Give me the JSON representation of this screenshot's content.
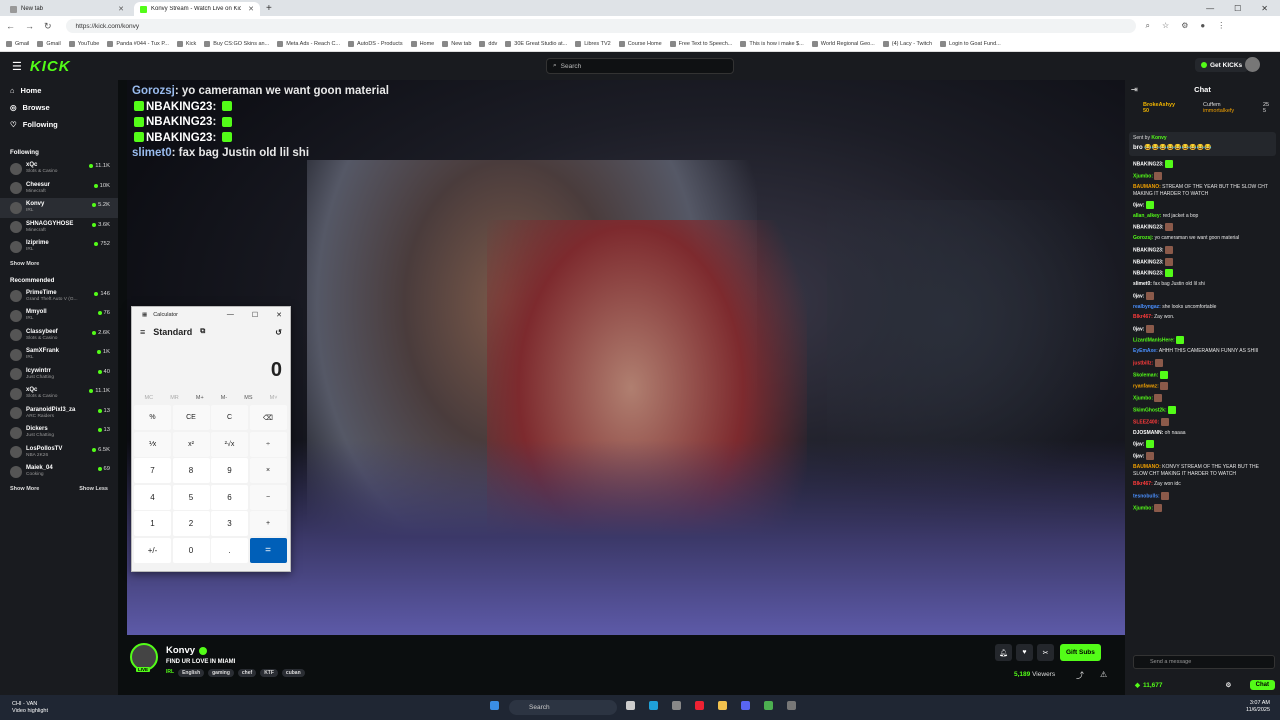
{
  "browser": {
    "tabs": [
      {
        "label": "New tab"
      },
      {
        "label": "Konvy Stream - Watch Live on Kick"
      }
    ],
    "url": "https://kick.com/konvy",
    "bookmarks": [
      "Gmail",
      "Gmail",
      "YouTube",
      "Panda #044 - Tux P...",
      "Kick",
      "Buy CS:GO Skins an...",
      "Meta Ads - Reach C...",
      "AutoDS - Products",
      "Home",
      "New tab",
      "ddv",
      "30E Great Studio at...",
      "Libres TV2",
      "Course Home",
      "Free Text to Speech...",
      "This is how i make $...",
      "World Regional Geo...",
      "(4) Lacy - Twitch",
      "Login to Goat Fund..."
    ]
  },
  "kick": {
    "logo": "KICK",
    "search_placeholder": "Search",
    "get_kicks": "Get KICKs",
    "nav": {
      "home": "Home",
      "browse": "Browse",
      "following": "Following"
    },
    "following_title": "Following",
    "following": [
      {
        "name": "xQc",
        "category": "Slots & Casino",
        "viewers": "11.1K"
      },
      {
        "name": "Cheesur",
        "category": "Minecraft",
        "viewers": "10K"
      },
      {
        "name": "Konvy",
        "category": "IRL",
        "viewers": "5.2K"
      },
      {
        "name": "SHNAGGYHOSE",
        "category": "Minecraft",
        "viewers": "3.6K"
      },
      {
        "name": "Iziprime",
        "category": "IRL",
        "viewers": "752"
      }
    ],
    "show_more": "Show More",
    "recommended_title": "Recommended",
    "recommended": [
      {
        "name": "PrimeTime",
        "category": "Grand Theft Auto V (G...",
        "viewers": "146"
      },
      {
        "name": "Mmyoll",
        "category": "IRL",
        "viewers": "76"
      },
      {
        "name": "Classybeef",
        "category": "Slots & Casino",
        "viewers": "2.6K"
      },
      {
        "name": "SamXFrank",
        "category": "IRL",
        "viewers": "1K"
      },
      {
        "name": "Icywintrr",
        "category": "Just Chatting",
        "viewers": "40"
      },
      {
        "name": "xQc",
        "category": "Slots & Casino",
        "viewers": "11.1K"
      },
      {
        "name": "ParanoidPixl3_za",
        "category": "ARC Raiders",
        "viewers": "13"
      },
      {
        "name": "Dickers",
        "category": "Just Chatting",
        "viewers": "13"
      },
      {
        "name": "LosPollosTV",
        "category": "NBA 2K26",
        "viewers": "6.5K"
      },
      {
        "name": "Maiek_04",
        "category": "Cooking",
        "viewers": "69"
      }
    ],
    "show_more_2": "Show More",
    "show_less": "Show Less",
    "overlay_chat": [
      {
        "user": "Gorozsj",
        "text": "yo cameraman we want goon material"
      },
      {
        "user": "NBAKING23",
        "text": ""
      },
      {
        "user": "NBAKING23",
        "text": ""
      },
      {
        "user": "NBAKING23",
        "text": ""
      },
      {
        "user": "slimet0",
        "text": "fax bag Justin old lil shi"
      }
    ],
    "stream": {
      "name": "Konvy",
      "live": "LIVE",
      "title": "FIND UR LOVE IN MIAMI",
      "category": "IRL",
      "tags": [
        "English",
        "gaming",
        "chef",
        "KTF",
        "cuban"
      ],
      "gift_subs": "Gift Subs",
      "viewers": "5,189",
      "viewers_label": "Viewers"
    },
    "chat": {
      "title": "Chat",
      "pinned": {
        "gifter": "BrokeAshyy",
        "gifter_count": "50",
        "user1": "Cuffem",
        "user1_count": "25",
        "user2": "immortalkefy",
        "user2_count": "5"
      },
      "sent_by": "Sent by",
      "sent_user": "Konvy",
      "sent_text": "bro 😂😂😂😂😂😂😂😂😂",
      "messages": [
        {
          "user": "NBAKING23:",
          "text": "",
          "color": "#ffffff",
          "emote": true
        },
        {
          "user": "Xjumbo:",
          "text": "",
          "color": "#53fc18",
          "emote": true
        },
        {
          "user": "BAUMANO:",
          "text": "STREAM OF THE YEAR BUT THE SLOW CHT MAKING IT HARDER TO WATCH",
          "color": "#f0a000"
        },
        {
          "user": "0jav:",
          "text": "",
          "color": "#ffffff",
          "emote": true
        },
        {
          "user": "allan_alkey:",
          "text": "red jacket a bop",
          "color": "#53fc18"
        },
        {
          "user": "NBAKING23:",
          "text": "",
          "color": "#ffffff",
          "emote": true
        },
        {
          "user": "Gorozsj:",
          "text": "yo cameraman we want goon material",
          "color": "#53fc18"
        },
        {
          "user": "NBAKING23:",
          "text": "",
          "color": "#ffffff",
          "emote": true
        },
        {
          "user": "NBAKING23:",
          "text": "",
          "color": "#ffffff",
          "emote": true
        },
        {
          "user": "NBAKING23:",
          "text": "",
          "color": "#ffffff",
          "emote": true
        },
        {
          "user": "slimet0:",
          "text": "fax bag Justin old lil shi",
          "color": "#ffffff"
        },
        {
          "user": "0jav:",
          "text": "",
          "color": "#ffffff",
          "emote": true
        },
        {
          "user": "realbyngaz:",
          "text": "she looks uncomfortable",
          "color": "#4a90ff"
        },
        {
          "user": "Blkr467:",
          "text": "Zay won.",
          "color": "#ff3b3b"
        },
        {
          "user": "0jav:",
          "text": "",
          "color": "#ffffff",
          "emote": true
        },
        {
          "user": "LizardManIsHere:",
          "text": "",
          "color": "#53fc18",
          "emote": true
        },
        {
          "user": "EyEmAxe:",
          "text": "AHHH THIS CAMERAMAN FUNNY AS SHIII",
          "color": "#4a90ff"
        },
        {
          "user": "justbillz:",
          "text": "",
          "color": "#ff3b3b",
          "emote": true
        },
        {
          "user": "Skoleman:",
          "text": "",
          "color": "#53fc18",
          "emote": true
        },
        {
          "user": "ryanfawaz:",
          "text": "",
          "color": "#f0a000",
          "emote": true
        },
        {
          "user": "Xjumbo:",
          "text": "",
          "color": "#53fc18",
          "emote": true
        },
        {
          "user": "SkimGhost2k:",
          "text": "",
          "color": "#53fc18",
          "emote": true
        },
        {
          "user": "SLEEZ400:",
          "text": "",
          "color": "#ff3b3b",
          "emote": true
        },
        {
          "user": "DJOSMANN:",
          "text": "oh naaaa",
          "color": "#ffffff"
        },
        {
          "user": "0jav:",
          "text": "",
          "color": "#ffffff",
          "emote": true
        },
        {
          "user": "0jav:",
          "text": "",
          "color": "#ffffff",
          "emote": true
        },
        {
          "user": "BAUMANO:",
          "text": "KONVY STREAM OF THE YEAR BUT THE SLOW CHT MAKING IT HARDER TO WATCH",
          "color": "#f0a000"
        },
        {
          "user": "Blkr467:",
          "text": "Zay won idc",
          "color": "#ff3b3b"
        },
        {
          "user": "tesnobulls:",
          "text": "",
          "color": "#4a90ff",
          "emote": true
        },
        {
          "user": "Xjumbo:",
          "text": "",
          "color": "#53fc18",
          "emote": true
        }
      ],
      "input_placeholder": "Send a message",
      "kicks_balance": "11,677",
      "send_label": "Chat"
    }
  },
  "calculator": {
    "title": "Calculator",
    "mode": "Standard",
    "display": "0",
    "memory": [
      "MC",
      "MR",
      "M+",
      "M-",
      "MS",
      "M˅"
    ],
    "keys": [
      "%",
      "CE",
      "C",
      "⌫",
      "⅟x",
      "x²",
      "²√x",
      "÷",
      "7",
      "8",
      "9",
      "×",
      "4",
      "5",
      "6",
      "−",
      "1",
      "2",
      "3",
      "+",
      "+/-",
      "0",
      ".",
      "="
    ]
  },
  "taskbar": {
    "weather_title": "CHI - VAN",
    "weather_sub": "Video highlight",
    "search": "Search",
    "time": "3:07 AM",
    "date": "11/6/2025"
  }
}
